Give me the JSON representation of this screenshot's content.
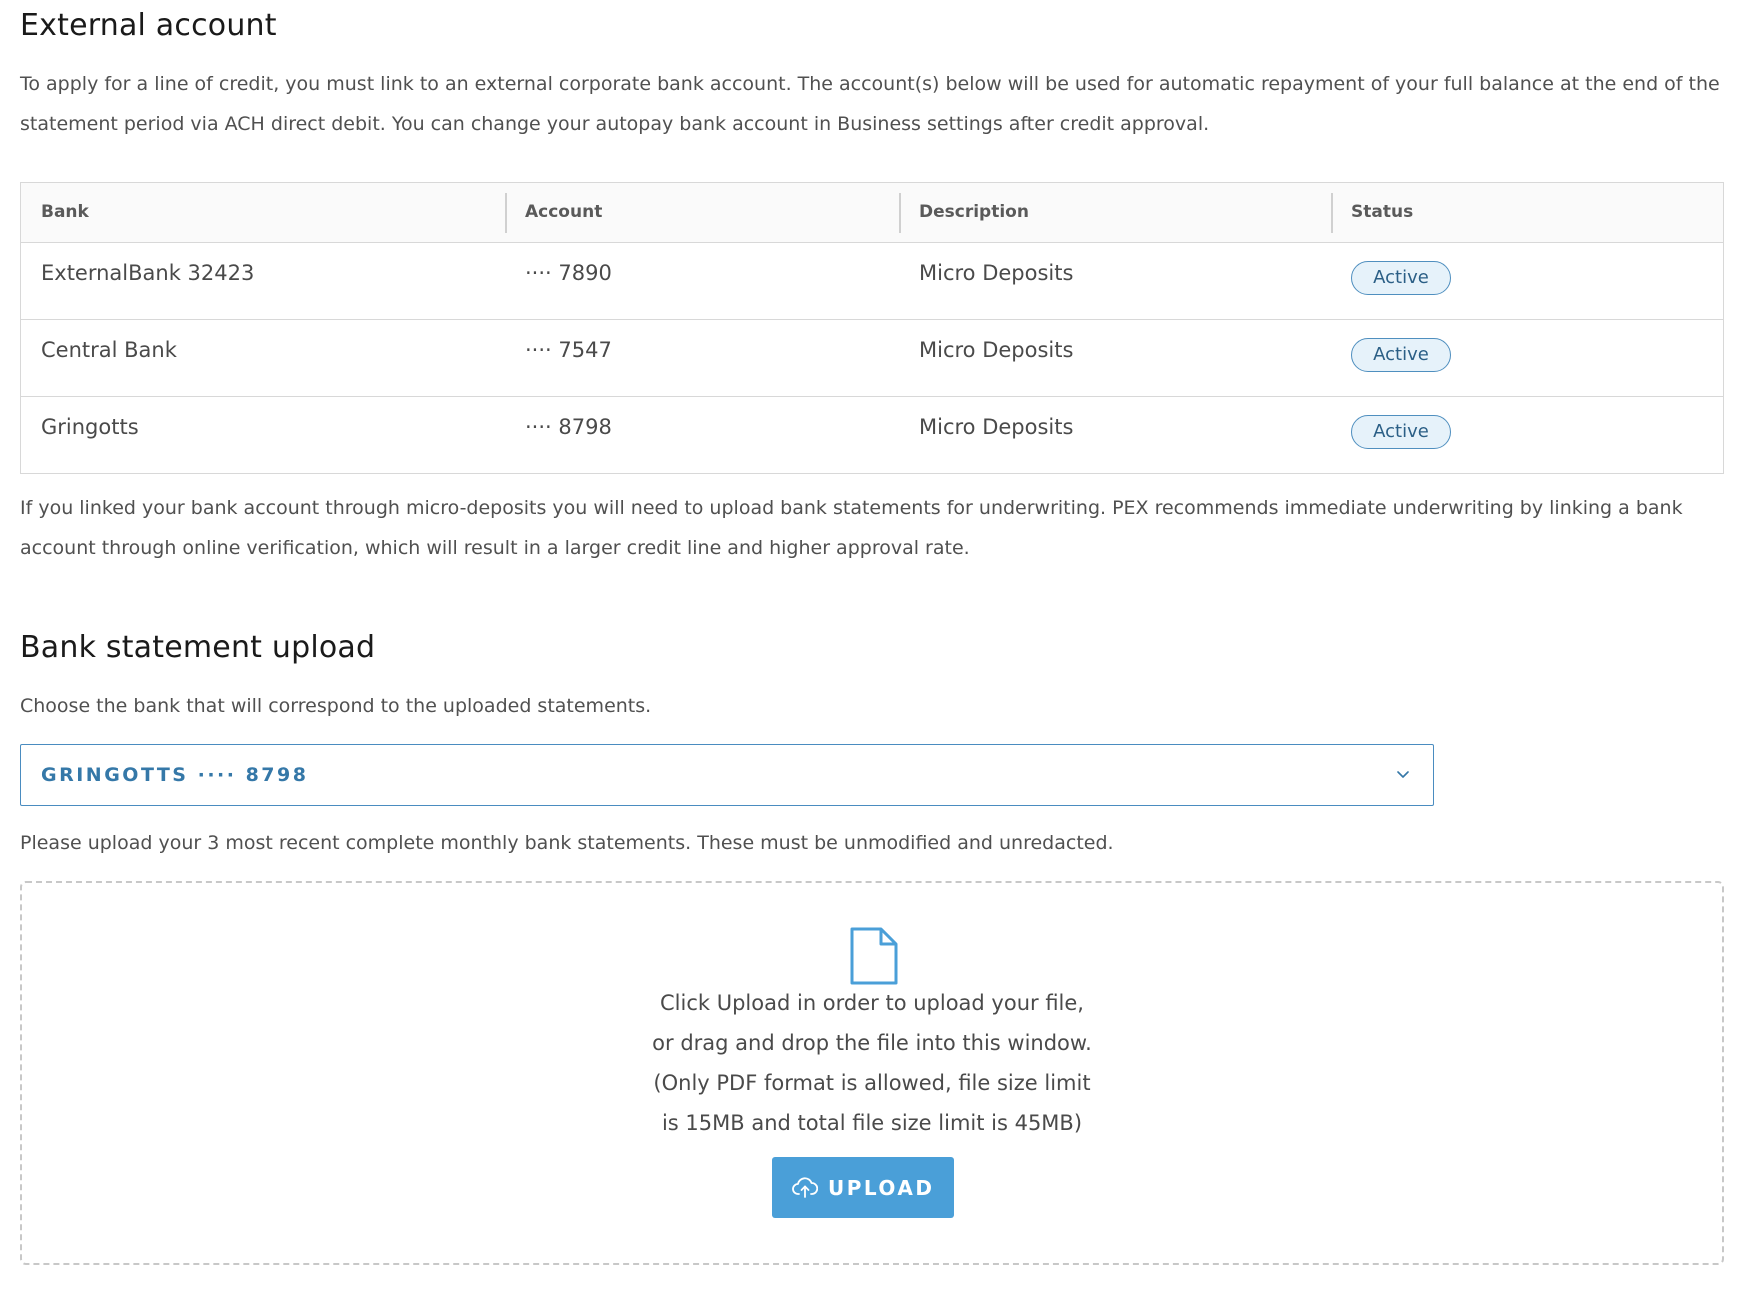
{
  "external": {
    "title": "External account",
    "intro": "To apply for a line of credit, you must link to an external corporate bank account. The account(s) below will be used for automatic repayment of your full balance at the end of the statement period via ACH direct debit. You can change your autopay bank account in Business settings after credit approval."
  },
  "table": {
    "headers": [
      "Bank",
      "Account",
      "Description",
      "Status"
    ],
    "rows": [
      {
        "bank": "ExternalBank 32423",
        "account": "···· 7890",
        "description": "Micro Deposits",
        "status": "Active"
      },
      {
        "bank": "Central Bank",
        "account": "···· 7547",
        "description": "Micro Deposits",
        "status": "Active"
      },
      {
        "bank": "Gringotts",
        "account": "···· 8798",
        "description": "Micro Deposits",
        "status": "Active"
      }
    ]
  },
  "micro_note": "If you linked your bank account through micro-deposits you will need to upload bank statements for underwriting. PEX recommends immediate underwriting by linking a bank account through online verification, which will result in a larger credit line and higher approval rate.",
  "upload": {
    "title": "Bank statement upload",
    "choose_text": "Choose the bank that will correspond to the uploaded statements.",
    "selected_bank": "GRINGOTTS ···· 8798",
    "recent_text": "Please upload your 3 most recent complete monthly bank statements. These must be unmodified and unredacted.",
    "drop_lines": [
      "Click Upload in order to upload your file,",
      "or drag and drop the file into this window.",
      "(Only PDF format is allowed, file size limit",
      "is 15MB and total file size limit is 45MB)"
    ],
    "button_label": "UPLOAD"
  },
  "colors": {
    "accent": "#4a9fd8",
    "select_text": "#3578a8",
    "badge_bg": "#e6f2fa",
    "badge_border": "#4f8fbf"
  },
  "icons": {
    "select_chevron": "chevron-down-icon",
    "file": "file-icon",
    "upload": "cloud-upload-icon"
  }
}
